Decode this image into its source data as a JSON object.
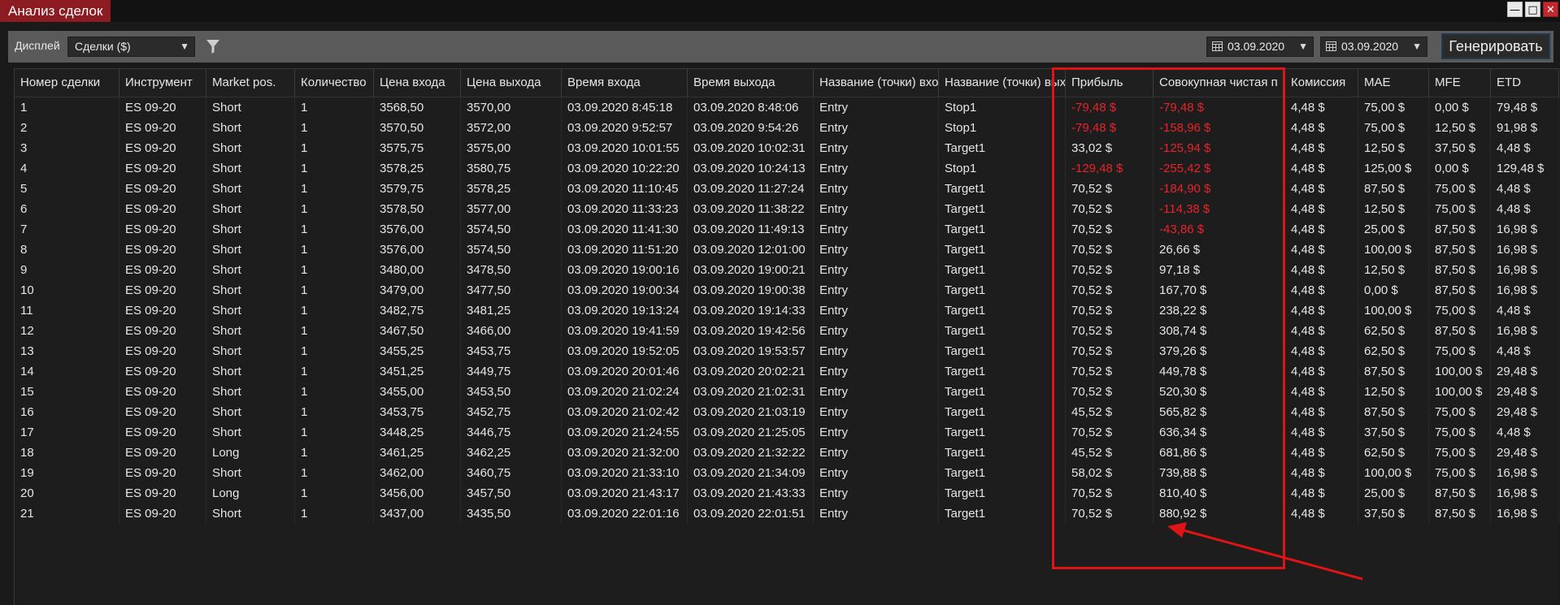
{
  "window": {
    "title": "Анализ сделок",
    "buttons": [
      "minimize",
      "maximize",
      "close"
    ]
  },
  "toolbar": {
    "display_label": "Дисплей",
    "display_value": "Сделки ($)",
    "date_from": "03.09.2020",
    "date_to": "03.09.2020",
    "generate_label": "Генерировать"
  },
  "colors": {
    "negative": "#e8232a",
    "title_accent": "#8c1c22",
    "highlight": "#e01414"
  },
  "columns": [
    "Номер сделки",
    "Инструмент",
    "Market pos.",
    "Количество",
    "Цена входа",
    "Цена выхода",
    "Время входа",
    "Время выхода",
    "Название (точки) вход",
    "Название (точки) вых",
    "Прибыль",
    "Совокупная чистая п",
    "Комиссия",
    "MAE",
    "MFE",
    "ETD"
  ],
  "rows": [
    [
      "1",
      "ES 09-20",
      "Short",
      "1",
      "3568,50",
      "3570,00",
      "03.09.2020 8:45:18",
      "03.09.2020 8:48:06",
      "Entry",
      "Stop1",
      "-79,48 $",
      "-79,48 $",
      "4,48 $",
      "75,00 $",
      "0,00 $",
      "79,48 $"
    ],
    [
      "2",
      "ES 09-20",
      "Short",
      "1",
      "3570,50",
      "3572,00",
      "03.09.2020 9:52:57",
      "03.09.2020 9:54:26",
      "Entry",
      "Stop1",
      "-79,48 $",
      "-158,96 $",
      "4,48 $",
      "75,00 $",
      "12,50 $",
      "91,98 $"
    ],
    [
      "3",
      "ES 09-20",
      "Short",
      "1",
      "3575,75",
      "3575,00",
      "03.09.2020 10:01:55",
      "03.09.2020 10:02:31",
      "Entry",
      "Target1",
      "33,02 $",
      "-125,94 $",
      "4,48 $",
      "12,50 $",
      "37,50 $",
      "4,48 $"
    ],
    [
      "4",
      "ES 09-20",
      "Short",
      "1",
      "3578,25",
      "3580,75",
      "03.09.2020 10:22:20",
      "03.09.2020 10:24:13",
      "Entry",
      "Stop1",
      "-129,48 $",
      "-255,42 $",
      "4,48 $",
      "125,00 $",
      "0,00 $",
      "129,48 $"
    ],
    [
      "5",
      "ES 09-20",
      "Short",
      "1",
      "3579,75",
      "3578,25",
      "03.09.2020 11:10:45",
      "03.09.2020 11:27:24",
      "Entry",
      "Target1",
      "70,52 $",
      "-184,90 $",
      "4,48 $",
      "87,50 $",
      "75,00 $",
      "4,48 $"
    ],
    [
      "6",
      "ES 09-20",
      "Short",
      "1",
      "3578,50",
      "3577,00",
      "03.09.2020 11:33:23",
      "03.09.2020 11:38:22",
      "Entry",
      "Target1",
      "70,52 $",
      "-114,38 $",
      "4,48 $",
      "12,50 $",
      "75,00 $",
      "4,48 $"
    ],
    [
      "7",
      "ES 09-20",
      "Short",
      "1",
      "3576,00",
      "3574,50",
      "03.09.2020 11:41:30",
      "03.09.2020 11:49:13",
      "Entry",
      "Target1",
      "70,52 $",
      "-43,86 $",
      "4,48 $",
      "25,00 $",
      "87,50 $",
      "16,98 $"
    ],
    [
      "8",
      "ES 09-20",
      "Short",
      "1",
      "3576,00",
      "3574,50",
      "03.09.2020 11:51:20",
      "03.09.2020 12:01:00",
      "Entry",
      "Target1",
      "70,52 $",
      "26,66 $",
      "4,48 $",
      "100,00 $",
      "87,50 $",
      "16,98 $"
    ],
    [
      "9",
      "ES 09-20",
      "Short",
      "1",
      "3480,00",
      "3478,50",
      "03.09.2020 19:00:16",
      "03.09.2020 19:00:21",
      "Entry",
      "Target1",
      "70,52 $",
      "97,18 $",
      "4,48 $",
      "12,50 $",
      "87,50 $",
      "16,98 $"
    ],
    [
      "10",
      "ES 09-20",
      "Short",
      "1",
      "3479,00",
      "3477,50",
      "03.09.2020 19:00:34",
      "03.09.2020 19:00:38",
      "Entry",
      "Target1",
      "70,52 $",
      "167,70 $",
      "4,48 $",
      "0,00 $",
      "87,50 $",
      "16,98 $"
    ],
    [
      "11",
      "ES 09-20",
      "Short",
      "1",
      "3482,75",
      "3481,25",
      "03.09.2020 19:13:24",
      "03.09.2020 19:14:33",
      "Entry",
      "Target1",
      "70,52 $",
      "238,22 $",
      "4,48 $",
      "100,00 $",
      "75,00 $",
      "4,48 $"
    ],
    [
      "12",
      "ES 09-20",
      "Short",
      "1",
      "3467,50",
      "3466,00",
      "03.09.2020 19:41:59",
      "03.09.2020 19:42:56",
      "Entry",
      "Target1",
      "70,52 $",
      "308,74 $",
      "4,48 $",
      "62,50 $",
      "87,50 $",
      "16,98 $"
    ],
    [
      "13",
      "ES 09-20",
      "Short",
      "1",
      "3455,25",
      "3453,75",
      "03.09.2020 19:52:05",
      "03.09.2020 19:53:57",
      "Entry",
      "Target1",
      "70,52 $",
      "379,26 $",
      "4,48 $",
      "62,50 $",
      "75,00 $",
      "4,48 $"
    ],
    [
      "14",
      "ES 09-20",
      "Short",
      "1",
      "3451,25",
      "3449,75",
      "03.09.2020 20:01:46",
      "03.09.2020 20:02:21",
      "Entry",
      "Target1",
      "70,52 $",
      "449,78 $",
      "4,48 $",
      "87,50 $",
      "100,00 $",
      "29,48 $"
    ],
    [
      "15",
      "ES 09-20",
      "Short",
      "1",
      "3455,00",
      "3453,50",
      "03.09.2020 21:02:24",
      "03.09.2020 21:02:31",
      "Entry",
      "Target1",
      "70,52 $",
      "520,30 $",
      "4,48 $",
      "12,50 $",
      "100,00 $",
      "29,48 $"
    ],
    [
      "16",
      "ES 09-20",
      "Short",
      "1",
      "3453,75",
      "3452,75",
      "03.09.2020 21:02:42",
      "03.09.2020 21:03:19",
      "Entry",
      "Target1",
      "45,52 $",
      "565,82 $",
      "4,48 $",
      "87,50 $",
      "75,00 $",
      "29,48 $"
    ],
    [
      "17",
      "ES 09-20",
      "Short",
      "1",
      "3448,25",
      "3446,75",
      "03.09.2020 21:24:55",
      "03.09.2020 21:25:05",
      "Entry",
      "Target1",
      "70,52 $",
      "636,34 $",
      "4,48 $",
      "37,50 $",
      "75,00 $",
      "4,48 $"
    ],
    [
      "18",
      "ES 09-20",
      "Long",
      "1",
      "3461,25",
      "3462,25",
      "03.09.2020 21:32:00",
      "03.09.2020 21:32:22",
      "Entry",
      "Target1",
      "45,52 $",
      "681,86 $",
      "4,48 $",
      "62,50 $",
      "75,00 $",
      "29,48 $"
    ],
    [
      "19",
      "ES 09-20",
      "Short",
      "1",
      "3462,00",
      "3460,75",
      "03.09.2020 21:33:10",
      "03.09.2020 21:34:09",
      "Entry",
      "Target1",
      "58,02 $",
      "739,88 $",
      "4,48 $",
      "100,00 $",
      "75,00 $",
      "16,98 $"
    ],
    [
      "20",
      "ES 09-20",
      "Long",
      "1",
      "3456,00",
      "3457,50",
      "03.09.2020 21:43:17",
      "03.09.2020 21:43:33",
      "Entry",
      "Target1",
      "70,52 $",
      "810,40 $",
      "4,48 $",
      "25,00 $",
      "87,50 $",
      "16,98 $"
    ],
    [
      "21",
      "ES 09-20",
      "Short",
      "1",
      "3437,00",
      "3435,50",
      "03.09.2020 22:01:16",
      "03.09.2020 22:01:51",
      "Entry",
      "Target1",
      "70,52 $",
      "880,92 $",
      "4,48 $",
      "37,50 $",
      "87,50 $",
      "16,98 $"
    ]
  ]
}
